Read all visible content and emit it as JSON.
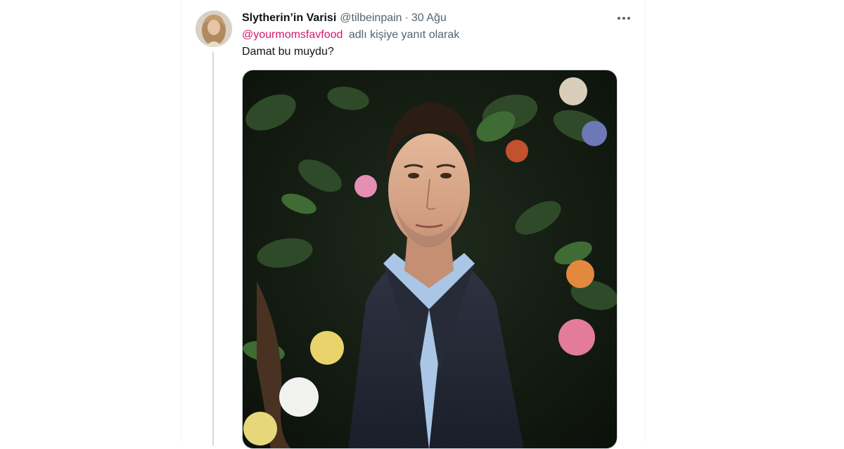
{
  "tweet": {
    "author": {
      "display_name": "Slytherin’in Varisi",
      "handle": "@tilbeinpain",
      "avatar_icon": "profile-photo"
    },
    "separator": "·",
    "date": "30 Ağu",
    "reply_to": {
      "mention": "@yourmomsfavfood",
      "suffix": "adlı kişiye yanıt olarak"
    },
    "text": "Damat bu muydu?",
    "media": {
      "kind": "photo",
      "description_icon": "portrait-photo"
    },
    "more_icon": "more-icon"
  },
  "colors": {
    "mention": "#d6186f",
    "secondary_text": "#536471",
    "thread_line": "#cfd9de"
  }
}
